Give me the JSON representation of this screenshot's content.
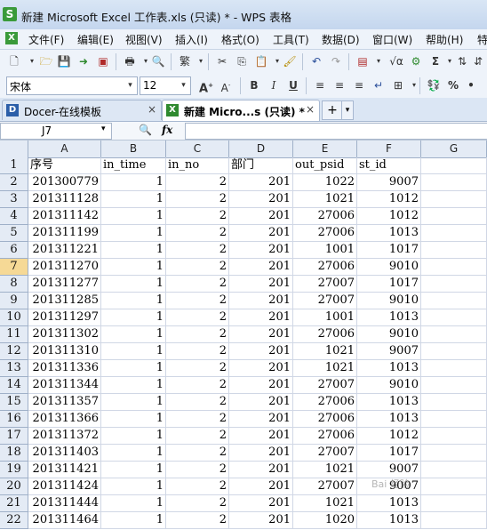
{
  "window": {
    "title": "新建 Microsoft Excel 工作表.xls (只读) * - WPS 表格",
    "logo": "S"
  },
  "menu": [
    "文件(F)",
    "编辑(E)",
    "视图(V)",
    "插入(I)",
    "格式(O)",
    "工具(T)",
    "数据(D)",
    "窗口(W)",
    "帮助(H)",
    "特"
  ],
  "format": {
    "font": "宋体",
    "size": "12"
  },
  "tabs": [
    {
      "label": "Docer-在线模板",
      "icon": "D"
    },
    {
      "label": "新建 Micro...s (只读) *",
      "icon": "X"
    }
  ],
  "formula": {
    "cell_ref": "J7",
    "fx": "fx",
    "value": ""
  },
  "columns": [
    "A",
    "B",
    "C",
    "D",
    "E",
    "F",
    "G"
  ],
  "headers": [
    "序号",
    "in_time",
    "in_no",
    "部门",
    "out_psid",
    "st_id"
  ],
  "rows": [
    [
      "201300779",
      "1",
      "2",
      "201",
      "1022",
      "9007"
    ],
    [
      "201311128",
      "1",
      "2",
      "201",
      "1021",
      "1012"
    ],
    [
      "201311142",
      "1",
      "2",
      "201",
      "27006",
      "1012"
    ],
    [
      "201311199",
      "1",
      "2",
      "201",
      "27006",
      "1013"
    ],
    [
      "201311221",
      "1",
      "2",
      "201",
      "1001",
      "1017"
    ],
    [
      "201311270",
      "1",
      "2",
      "201",
      "27006",
      "9010"
    ],
    [
      "201311277",
      "1",
      "2",
      "201",
      "27007",
      "1017"
    ],
    [
      "201311285",
      "1",
      "2",
      "201",
      "27007",
      "9010"
    ],
    [
      "201311297",
      "1",
      "2",
      "201",
      "1001",
      "1013"
    ],
    [
      "201311302",
      "1",
      "2",
      "201",
      "27006",
      "9010"
    ],
    [
      "201311310",
      "1",
      "2",
      "201",
      "1021",
      "9007"
    ],
    [
      "201311336",
      "1",
      "2",
      "201",
      "1021",
      "1013"
    ],
    [
      "201311344",
      "1",
      "2",
      "201",
      "27007",
      "9010"
    ],
    [
      "201311357",
      "1",
      "2",
      "201",
      "27006",
      "1013"
    ],
    [
      "201311366",
      "1",
      "2",
      "201",
      "27006",
      "1013"
    ],
    [
      "201311372",
      "1",
      "2",
      "201",
      "27006",
      "1012"
    ],
    [
      "201311403",
      "1",
      "2",
      "201",
      "27007",
      "1017"
    ],
    [
      "201311421",
      "1",
      "2",
      "201",
      "1021",
      "9007"
    ],
    [
      "201311424",
      "1",
      "2",
      "201",
      "27007",
      "9007"
    ],
    [
      "201311444",
      "1",
      "2",
      "201",
      "1021",
      "1013"
    ],
    [
      "201311464",
      "1",
      "2",
      "201",
      "1020",
      "1013"
    ]
  ],
  "selected_row": 7,
  "watermark": "Bai 经验",
  "colors": {
    "logo_green": "#3a9a3a",
    "selected_row_header": "#f6d996",
    "header_bg": "#e4ebf5"
  }
}
